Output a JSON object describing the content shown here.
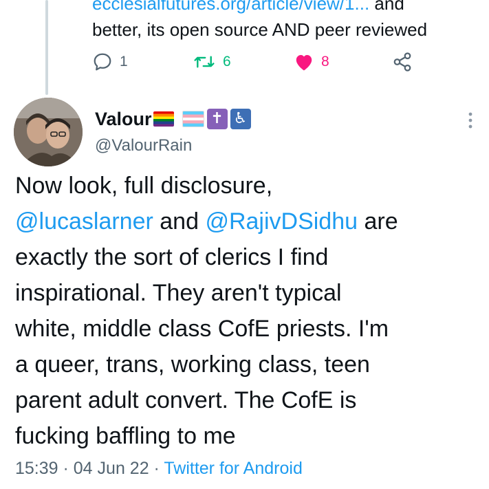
{
  "previous_tweet": {
    "text_line1_link": "ecclesialfutures.org/article/view/1...",
    "text_line1_rest": " and",
    "text_line2": "better, its open source AND peer reviewed",
    "reply_count": "1",
    "retweet_count": "6",
    "like_count": "8"
  },
  "tweet": {
    "display_name": "Valour",
    "handle": "@ValourRain",
    "body": {
      "l1": "Now look, full disclosure,",
      "mention1": "@lucaslarner",
      "and": " and ",
      "mention2": "@RajivDSidhu",
      "are": " are",
      "l3": "exactly the sort of clerics I find",
      "l4": "inspirational. They aren't typical",
      "l5": "white, middle class CofE priests. I'm",
      "l6": "a queer, trans, working class, teen",
      "l7": "parent adult convert. The CofE is",
      "l8": "fucking baffling to me"
    },
    "time": "15:39",
    "sep1": " · ",
    "date": "04 Jun 22",
    "sep2": " · ",
    "source": "Twitter for Android"
  },
  "icons": {
    "reply": "reply-icon",
    "retweet": "retweet-icon",
    "like": "heart-icon",
    "share": "share-icon",
    "more": "more-icon"
  },
  "colors": {
    "link": "#1d9bf0",
    "retweet": "#00ba7c",
    "like": "#f91880",
    "secondary": "#536471"
  }
}
